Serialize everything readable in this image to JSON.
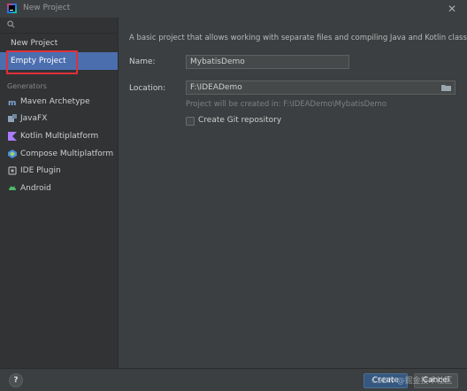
{
  "window": {
    "title": "New Project",
    "close_glyph": "✕",
    "logo_icon": "intellij-logo-icon"
  },
  "sidebar": {
    "search_icon": "search-icon",
    "items": [
      {
        "label": "New Project",
        "selected": false
      },
      {
        "label": "Empty Project",
        "selected": true
      }
    ],
    "generators_heading": "Generators",
    "generators": [
      {
        "label": "Maven Archetype",
        "icon": "maven-icon"
      },
      {
        "label": "JavaFX",
        "icon": "javafx-icon"
      },
      {
        "label": "Kotlin Multiplatform",
        "icon": "kotlin-icon"
      },
      {
        "label": "Compose Multiplatform",
        "icon": "compose-icon"
      },
      {
        "label": "IDE Plugin",
        "icon": "plugin-icon"
      },
      {
        "label": "Android",
        "icon": "android-icon"
      }
    ]
  },
  "main": {
    "description": "A basic project that allows working with separate files and compiling Java and Kotlin classes.",
    "name_label": "Name:",
    "name_value": "MybatisDemo",
    "location_label": "Location:",
    "location_value": "F:\\IDEADemo",
    "location_hint": "Project will be created in: F:\\IDEADemo\\MybatisDemo",
    "git_checkbox_label": "Create Git repository",
    "git_checked": false
  },
  "footer": {
    "help_label": "?",
    "create_label": "Create",
    "cancel_label": "Cancel"
  },
  "watermark": "CSDN @掘金技术社区",
  "colors": {
    "accent": "#4b6eaf",
    "highlight_border": "#e0303a",
    "primary_button": "#365880"
  }
}
